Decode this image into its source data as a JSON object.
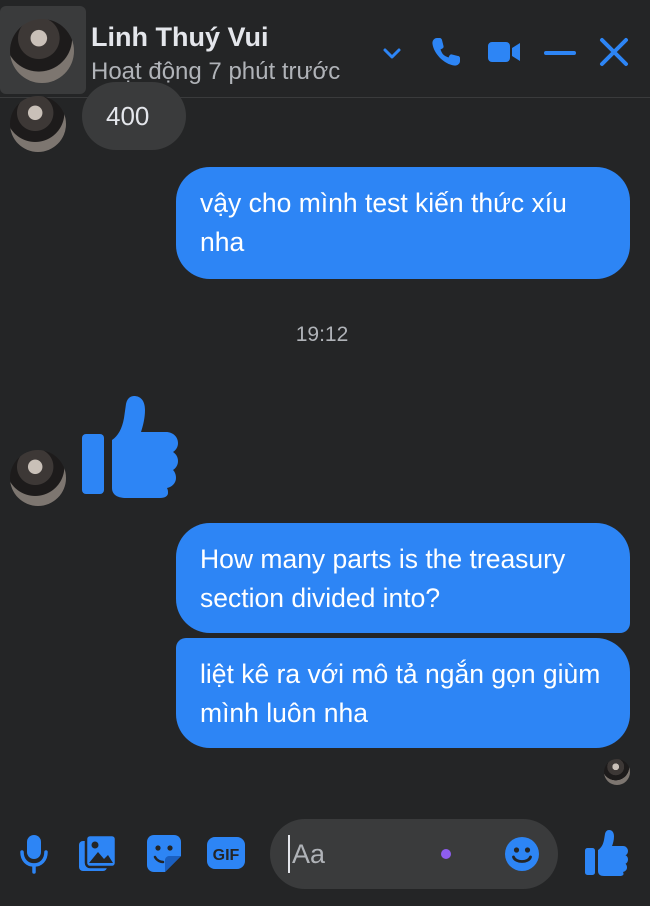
{
  "header": {
    "name": "Linh Thuý Vui",
    "status": "Hoạt động 7 phút trước"
  },
  "messages": {
    "incoming_number": "400",
    "outgoing_1": "vậy cho mình test kiến thức xíu nha",
    "timestamp": "19:12",
    "outgoing_2": "How many parts is the treasury section divided into?",
    "outgoing_3": "liệt kê ra với mô tả ngắn gọn giùm mình luôn nha"
  },
  "composer": {
    "placeholder": "Aa"
  },
  "icons": {
    "header": [
      "chevron-down-icon",
      "phone-icon",
      "video-icon",
      "minimize-icon",
      "close-icon"
    ],
    "composer": [
      "microphone-icon",
      "image-icon",
      "sticker-icon",
      "gif-icon",
      "emoji-icon",
      "like-icon"
    ]
  },
  "colors": {
    "accent": "#2d85f5",
    "background": "#242526",
    "incoming_bubble": "#3a3b3c"
  }
}
